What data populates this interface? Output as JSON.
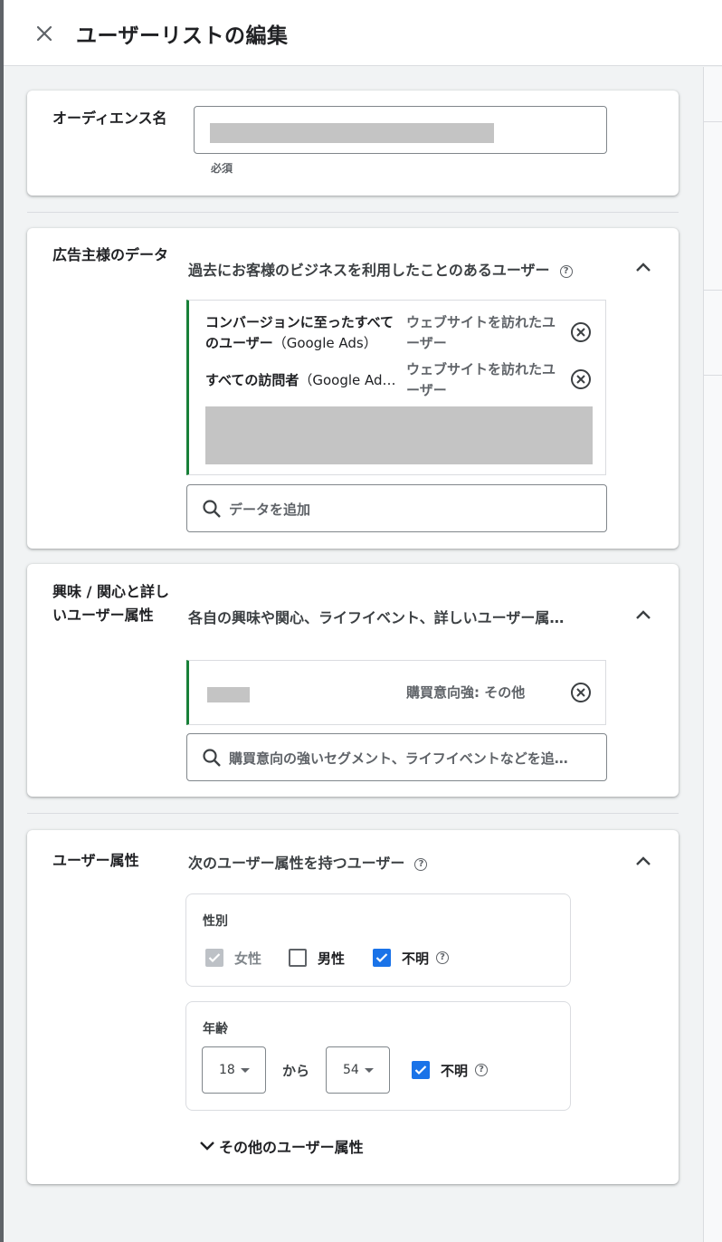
{
  "header": {
    "title": "ユーザーリストの編集",
    "close_icon": "close-icon"
  },
  "audience_name": {
    "label": "オーディエンス名",
    "value": "",
    "hint": "必須"
  },
  "advertiser_data": {
    "label": "広告主様のデータ",
    "summary": "過去にお客様のビジネスを利用したことのあるユーザー",
    "items": [
      {
        "name": "コンバージョンに至ったすべてのユーザー",
        "source": "（Google Ads）",
        "type": "ウェブサイトを訪れたユーザー"
      },
      {
        "name": "すべての訪問者",
        "source": "（Google Ad…",
        "type": "ウェブサイトを訪れたユーザー"
      }
    ],
    "search_placeholder": "データを追加"
  },
  "interests": {
    "label": "興味 / 関心と詳しいユーザー属性",
    "summary": "各自の興味や関心、ライフイベント、詳しいユーザー属…",
    "items": [
      {
        "name": "",
        "type": "購買意向強: その他"
      }
    ],
    "search_placeholder": "購買意向の強いセグメント、ライフイベントなどを追…"
  },
  "demographics": {
    "label": "ユーザー属性",
    "summary": "次のユーザー属性を持つユーザー",
    "gender": {
      "title": "性別",
      "options": [
        {
          "label": "女性",
          "state": "checked-disabled"
        },
        {
          "label": "男性",
          "state": "unchecked"
        },
        {
          "label": "不明",
          "state": "checked"
        }
      ]
    },
    "age": {
      "title": "年齢",
      "from": "18",
      "separator": "から",
      "to": "54",
      "unknown_label": "不明",
      "unknown_checked": true
    },
    "more_label": "その他のユーザー属性"
  },
  "colors": {
    "accent": "#1a73e8",
    "green_bar": "#188038",
    "disabled": "#bdc1c6"
  }
}
